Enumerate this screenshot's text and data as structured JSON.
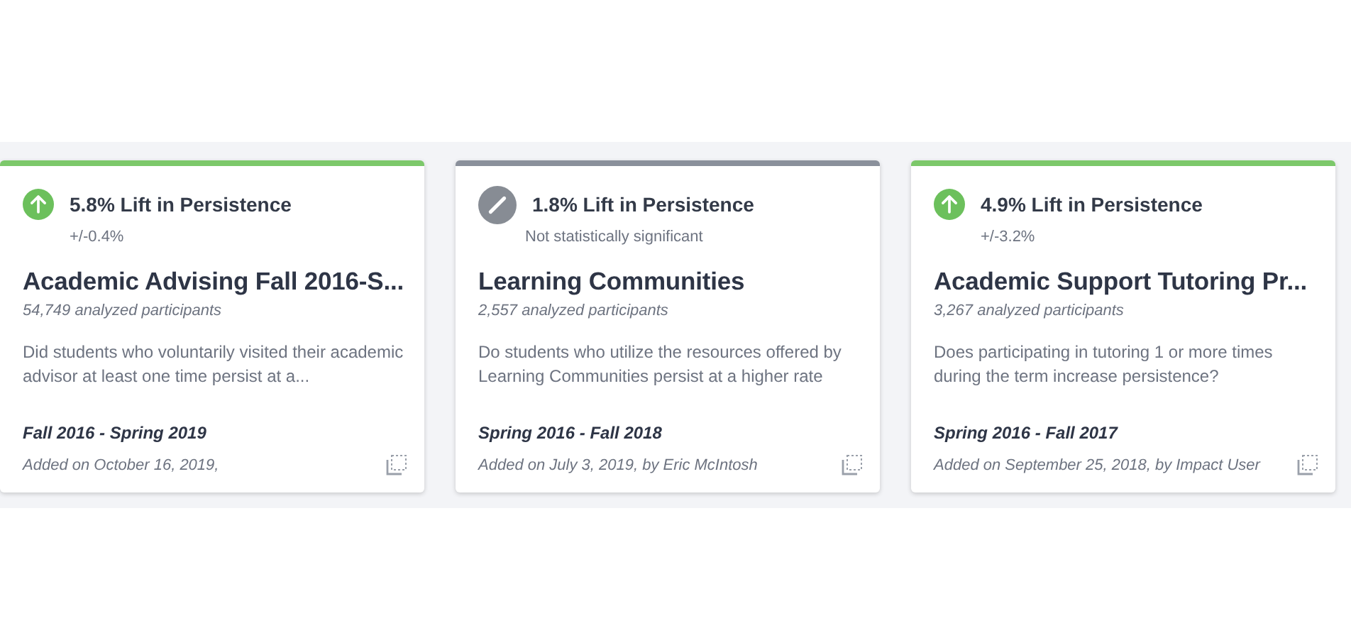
{
  "cards": [
    {
      "kind": "significant",
      "lift": "5.8% Lift in Persistence",
      "margin": "+/-0.4%",
      "title": "Academic Advising Fall 2016-S...",
      "participants": "54,749 analyzed participants",
      "description": "Did students who voluntarily visited their academic advisor at least one time persist at a...",
      "term": "Fall 2016 - Spring 2019",
      "added": "Added on October 16, 2019,"
    },
    {
      "kind": "not_significant",
      "lift": "1.8% Lift in Persistence",
      "margin": "Not statistically significant",
      "title": "Learning Communities",
      "participants": "2,557 analyzed participants",
      "description": "Do students who utilize the resources offered by Learning Communities persist at a higher rate",
      "term": "Spring 2016 - Fall 2018",
      "added": "Added on July 3, 2019, by Eric McIntosh"
    },
    {
      "kind": "significant",
      "lift": "4.9% Lift in Persistence",
      "margin": "+/-3.2%",
      "title": "Academic Support Tutoring Pr...",
      "participants": "3,267 analyzed participants",
      "description": "Does participating in tutoring 1 or more times during the term increase persistence?",
      "term": "Spring 2016 - Fall 2017",
      "added": "Added on September 25, 2018, by Impact User"
    }
  ]
}
